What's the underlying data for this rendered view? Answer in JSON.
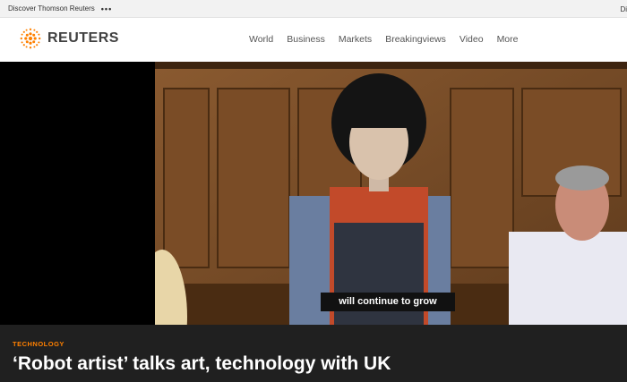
{
  "topbar": {
    "discover_label": "Discover Thomson Reuters",
    "more_label": "•••",
    "right_label": "Di"
  },
  "header": {
    "logo_text": "REUTERS",
    "accent": "#ff8000"
  },
  "nav": {
    "items": [
      "World",
      "Business",
      "Markets",
      "Breakingviews",
      "Video",
      "More"
    ]
  },
  "video": {
    "caption": "will continue to grow"
  },
  "article": {
    "kicker": "TECHNOLOGY",
    "headline": "‘Robot artist’ talks art, technology with UK"
  }
}
